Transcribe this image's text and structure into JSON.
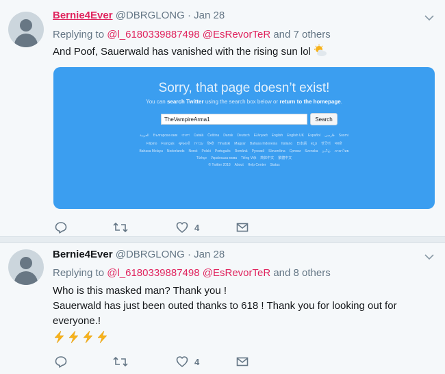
{
  "tweets": [
    {
      "name": "Bernie4Ever",
      "handle": "@DBRGLONG",
      "dot": "·",
      "date": "Jan 28",
      "replying_prefix": "Replying to",
      "mention_1": "@l_6180339887498",
      "mention_2": "@EsRevorTeR",
      "replying_suffix": "and 7 others",
      "text_lines": [
        "And Poof, Sauerwald has vanished with the rising sun lol"
      ],
      "like_count": "4",
      "card": {
        "title": "Sorry, that page doesn’t exist!",
        "sub_1": "You can ",
        "sub_link_1": "search Twitter",
        "sub_2": " using the search box below or ",
        "sub_link_2": "return to the homepage",
        "sub_3": ".",
        "search_value": "TheVampireArma1",
        "search_button": "Search",
        "lang_row_1": [
          "العربية",
          "Български език",
          "বাংলা",
          "Català",
          "Čeština",
          "Dansk",
          "Deutsch",
          "Ελληνικά",
          "English",
          "English UK",
          "Español",
          "فارسی",
          "Suomi"
        ],
        "lang_row_2": [
          "Filipino",
          "Français",
          "ગુજરાતી",
          "עברית",
          "हिन्दी",
          "Hrvatski",
          "Magyar",
          "Bahasa Indonesia",
          "Italiano",
          "日本語",
          "ಕನ್ನಡ",
          "한국어",
          "मराठी"
        ],
        "lang_row_3": [
          "Bahasa Melayu",
          "Nederlands",
          "Norsk",
          "Polski",
          "Português",
          "Română",
          "Русский",
          "Slovenčina",
          "Српски",
          "Svenska",
          "தமிழ்",
          "ภาษาไทย"
        ],
        "lang_row_4": [
          "Türkçe",
          "Українська мова",
          "Tiếng Việt",
          "简体中文",
          "繁體中文"
        ],
        "footer": [
          "© Twitter 2018",
          "About",
          "Help Center",
          "Status"
        ]
      }
    },
    {
      "name": "Bernie4Ever",
      "handle": "@DBRGLONG",
      "dot": "·",
      "date": "Jan 28",
      "replying_prefix": "Replying to",
      "mention_1": "@l_6180339887498",
      "mention_2": "@EsRevorTeR",
      "replying_suffix": "and 8 others",
      "text_lines": [
        "Who is this masked man? Thank you !",
        "Sauerwald has just been outed thanks to 618 ! Thank you  for looking out for",
        "everyone.!"
      ],
      "like_count": "4"
    }
  ],
  "icons": {
    "emoji_1": "sun-behind-cloud",
    "emoji_2": "high-voltage-x4",
    "reply": "reply-icon",
    "retweet": "retweet-icon",
    "like": "heart-icon",
    "dm": "envelope-icon"
  },
  "colors": {
    "accent": "#e0245e",
    "muted": "#657786",
    "card_blue": "#3b9ef0",
    "background": "#f5f8fa"
  }
}
